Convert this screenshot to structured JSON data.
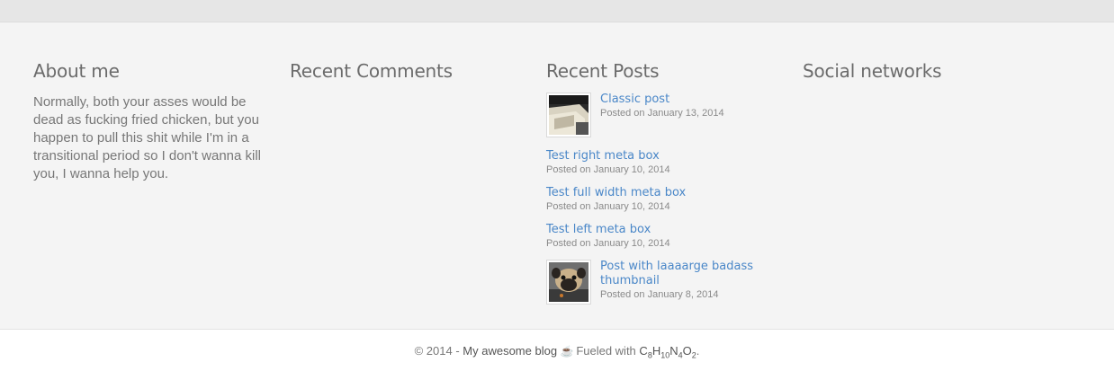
{
  "about": {
    "title": "About me",
    "text": "Normally, both your asses would be dead as fucking fried chicken, but you happen to pull this shit while I'm in a transitional period so I don't wanna kill you, I wanna help you."
  },
  "comments": {
    "title": "Recent Comments"
  },
  "posts": {
    "title": "Recent Posts",
    "items": [
      {
        "title": "Classic post",
        "date": "Posted on January 13, 2014",
        "thumb": "classic-thumbnail"
      },
      {
        "title": "Test right meta box",
        "date": "Posted on January 10, 2014"
      },
      {
        "title": "Test full width meta box",
        "date": "Posted on January 10, 2014"
      },
      {
        "title": "Test left meta box",
        "date": "Posted on January 10, 2014"
      },
      {
        "title": "Post with laaaarge badass thumbnail",
        "date": "Posted on January 8, 2014",
        "thumb": "pug-thumbnail"
      }
    ]
  },
  "social": {
    "title": "Social networks"
  },
  "footer": {
    "copyright": "© 2014 -",
    "blog_name": "My awesome blog",
    "fueled": "Fueled with",
    "formula_parts": [
      "C",
      "8",
      "H",
      "10",
      "N",
      "4",
      "O",
      "2"
    ],
    "end": "."
  },
  "colors": {
    "link": "#4a87c8",
    "widget_bg": "#f4f4f4",
    "topbar": "#e6e6e6"
  }
}
